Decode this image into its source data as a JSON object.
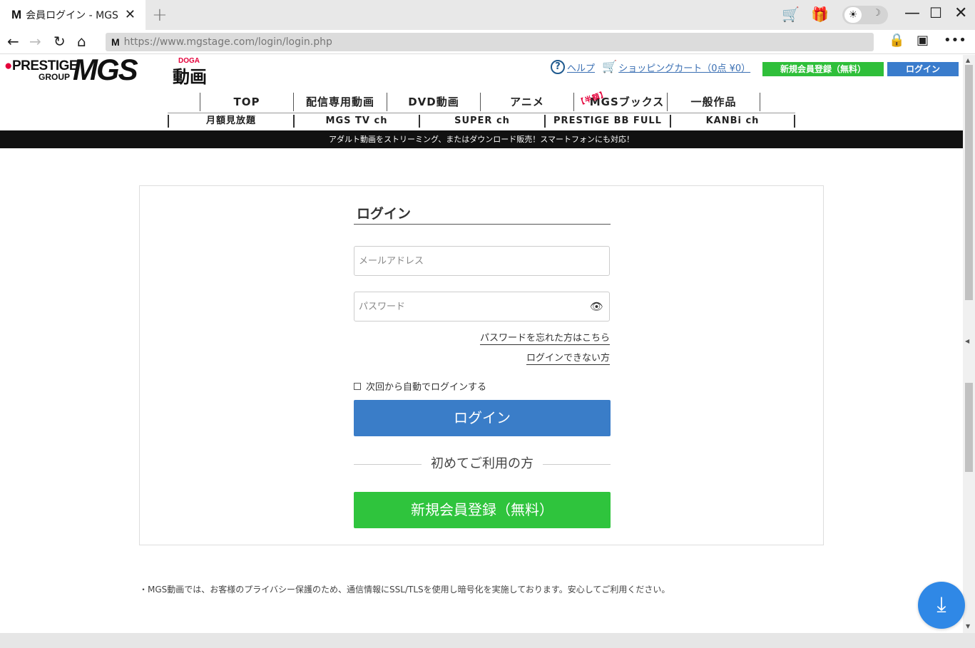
{
  "browser": {
    "tab_title": "会員ログイン - MGS",
    "tab_favicon": "M",
    "tab_close": "✕",
    "new_tab": "+",
    "url_favicon": "M",
    "url": "https://www.mgstage.com/login/login.php",
    "icons": [
      "back-icon",
      "forward-icon",
      "reload-icon",
      "home-icon",
      "lock-icon",
      "cast-icon",
      "more-icon",
      "cart-icon",
      "gift-icon",
      "sun-icon",
      "moon-icon",
      "minimize-icon",
      "maximize-icon",
      "close-icon"
    ]
  },
  "header": {
    "logo_prestige": "PRESTIGE",
    "logo_group": "GROUP",
    "logo_mgs": "MGS",
    "logo_doga": "DOGA",
    "logo_douga": "動画",
    "help_label": "ヘルプ",
    "cart_label": "ショッピングカート（0点 ¥0）",
    "register_label": "新規会員登録（無料）",
    "login_label": "ログイン"
  },
  "mainnav": {
    "items": [
      "TOP",
      "配信専用動画",
      "DVD動画",
      "アニメ",
      "MGSブックス",
      "一般作品"
    ],
    "hangaku": "【半額】"
  },
  "subnav": {
    "items": [
      "月額見放題",
      "MGS TV ch",
      "SUPER ch",
      "PRESTIGE BB FULL",
      "KANBi ch"
    ]
  },
  "banner": "アダルト動画をストリーミング、またはダウンロード販売！スマートフォンにも対応！",
  "login": {
    "title": "ログイン",
    "email_placeholder": "メールアドレス",
    "password_placeholder": "パスワード",
    "forgot_link": "パスワードを忘れた方はこちら",
    "cannot_login_link": "ログインできない方",
    "auto_login_label": "次回から自動でログインする",
    "login_button": "ログイン",
    "first_time": "初めてご利用の方",
    "register_button": "新規会員登録（無料）"
  },
  "privacy_note": "・MGS動画では、お客様のプライバシー保護のため、通信情報にSSL/TLSを使用し暗号化を実施しております。安心してご利用ください。",
  "colors": {
    "brand_red": "#e4003a",
    "login_blue": "#3a7dc8",
    "register_green": "#2fc43d",
    "fab_blue": "#2f88e6"
  }
}
